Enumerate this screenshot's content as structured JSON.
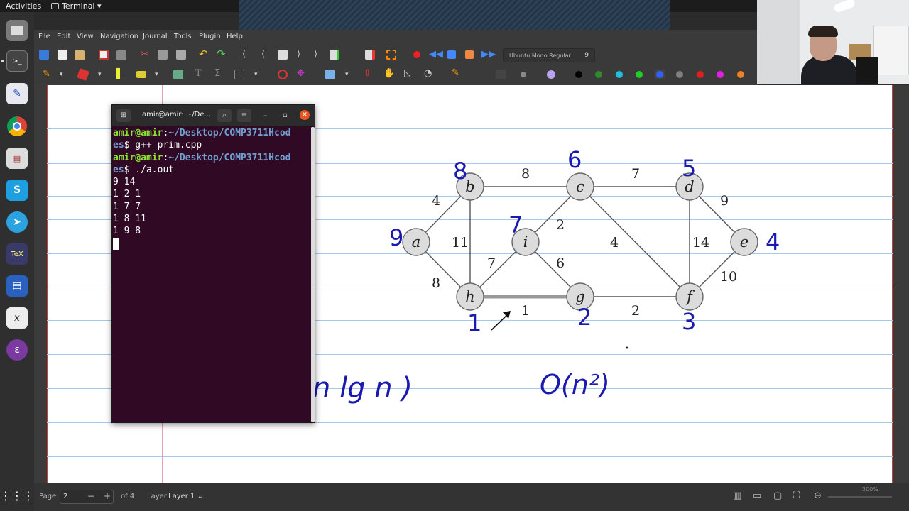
{
  "topbar": {
    "activities": "Activities",
    "app": "Terminal ▾"
  },
  "menubar": [
    "File",
    "Edit",
    "View",
    "Navigation",
    "Journal",
    "Tools",
    "Plugin",
    "Help"
  ],
  "toolbar": {
    "font_name": "Ubuntu Mono Regular",
    "font_size": "9"
  },
  "palette": [
    "#000000",
    "#2e8b2e",
    "#22c0e0",
    "#20d020",
    "#3060ff",
    "#808080",
    "#e02020",
    "#e020e0",
    "#f08020"
  ],
  "terminal": {
    "title": "amir@amir: ~/De...",
    "lines": [
      {
        "user": "amir@amir",
        "path": "~/Desktop/COMP3711Hcod",
        "cont": "es",
        "cmd": "$ g++ prim.cpp"
      },
      {
        "user": "amir@amir",
        "path": "~/Desktop/COMP3711Hcod",
        "cont": "es",
        "cmd": "$ ./a.out"
      }
    ],
    "output": [
      "9 14",
      "1 2 1",
      "1 7 7",
      "1 8 11",
      "1 9 8"
    ]
  },
  "graph": {
    "nodes": [
      "a",
      "b",
      "c",
      "d",
      "e",
      "f",
      "g",
      "h",
      "i"
    ],
    "edges": [
      {
        "from": "a",
        "to": "b",
        "w": "4"
      },
      {
        "from": "a",
        "to": "h",
        "w": "8"
      },
      {
        "from": "b",
        "to": "c",
        "w": "8"
      },
      {
        "from": "b",
        "to": "h",
        "w": "11"
      },
      {
        "from": "c",
        "to": "d",
        "w": "7"
      },
      {
        "from": "c",
        "to": "i",
        "w": "2"
      },
      {
        "from": "c",
        "to": "f",
        "w": "4"
      },
      {
        "from": "d",
        "to": "e",
        "w": "9"
      },
      {
        "from": "d",
        "to": "f",
        "w": "14"
      },
      {
        "from": "e",
        "to": "f",
        "w": "10"
      },
      {
        "from": "f",
        "to": "g",
        "w": "2"
      },
      {
        "from": "g",
        "to": "h",
        "w": "1"
      },
      {
        "from": "g",
        "to": "i",
        "w": "6"
      },
      {
        "from": "h",
        "to": "i",
        "w": "7"
      }
    ],
    "annotations": {
      "a": "9",
      "b": "8",
      "c": "6",
      "d": "5",
      "e": "4",
      "f": "3",
      "g": "2",
      "h": "1",
      "i": "7"
    }
  },
  "notes": {
    "left": "n lg n )",
    "right": "O(n²)"
  },
  "statusbar": {
    "page_label": "Page",
    "page_value": "2",
    "of_label": "of 4",
    "layer_label": "Layer",
    "layer_value": "Layer 1 ⌄",
    "zoom": "300%"
  }
}
